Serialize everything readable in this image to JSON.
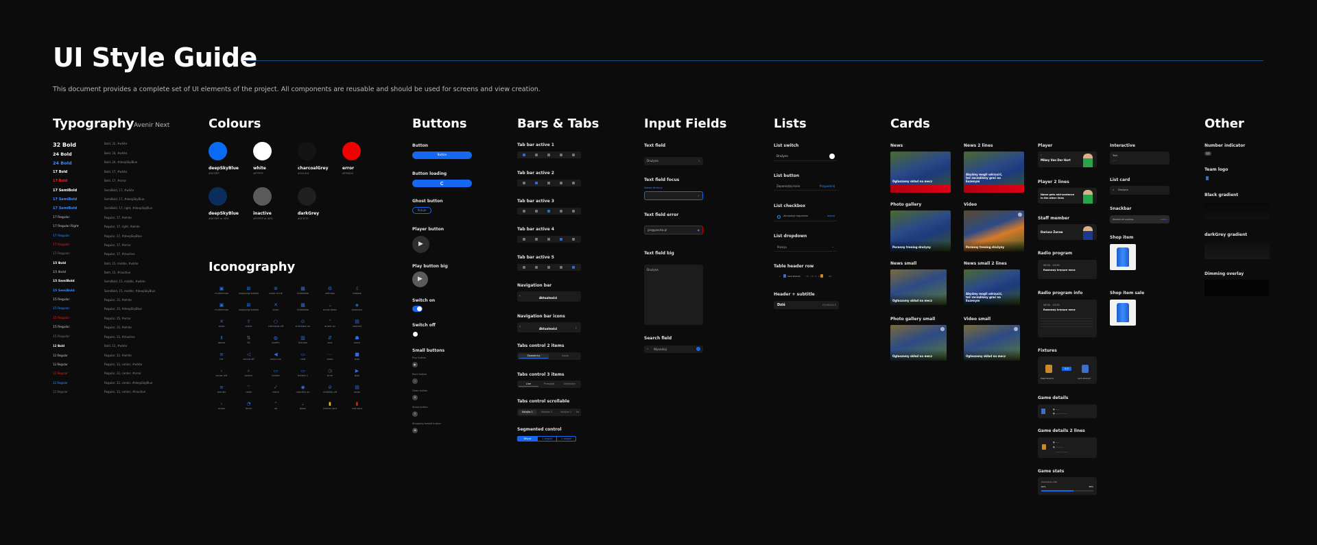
{
  "header": {
    "title": "UI Style Guide",
    "subtitle": "This document provides a complete set of UI elements of the project. All components are reusable and should be used for screens and view creation."
  },
  "typography": {
    "heading": "Typography",
    "font": "Avenir Next",
    "rows": [
      {
        "sample": "32 Bold",
        "spec": "Bold, 32, #white"
      },
      {
        "sample": "24 Bold",
        "spec": "Bold, 24, #white"
      },
      {
        "sample": "24 Bold",
        "spec": "Bold, 24, #deepSkyBlue"
      },
      {
        "sample": "17 Bold",
        "spec": "Bold, 17, #white"
      },
      {
        "sample": "17 Bold",
        "spec": "Bold, 17, #error"
      },
      {
        "sample": "17 SemiBold",
        "spec": "SemiBold, 17, #white"
      },
      {
        "sample": "17 SemiBold",
        "spec": "SemiBold, 17, #deepSkyBlue"
      },
      {
        "sample": "17 SemiBold",
        "spec": "SemiBold, 17, right, #deepSkyBlue"
      },
      {
        "sample": "17 Regular",
        "spec": "Regular, 17, #white"
      },
      {
        "sample": "17 Regular Right",
        "spec": "Regular, 17, right, #white"
      },
      {
        "sample": "17 Regular",
        "spec": "Regular, 17, #deepSkyBlue"
      },
      {
        "sample": "17 Regular",
        "spec": "Regular, 17, #error"
      },
      {
        "sample": "17 Regular",
        "spec": "Regular, 17, #inactive"
      },
      {
        "sample": "15 Bold",
        "spec": "Bold, 15, middle, #white"
      },
      {
        "sample": "15 Bold",
        "spec": "Bold, 15, #inactive"
      },
      {
        "sample": "15 SemiBold",
        "spec": "SemiBold, 15, middle, #white"
      },
      {
        "sample": "15 SemiBold",
        "spec": "SemiBold, 15, middle, #deepSkyBlue"
      },
      {
        "sample": "15 Regular",
        "spec": "Regular, 15, #white"
      },
      {
        "sample": "15 Regular",
        "spec": "Regular, 15, #deepSkyBlue"
      },
      {
        "sample": "15 Regular",
        "spec": "Regular, 15, #error"
      },
      {
        "sample": "15 Regular",
        "spec": "Regular, 15, #white"
      },
      {
        "sample": "15 Regular",
        "spec": "Regular, 15, #inactive"
      },
      {
        "sample": "12 Bold",
        "spec": "Bold, 12, #white"
      },
      {
        "sample": "12 Regular",
        "spec": "Regular, 12, #white"
      },
      {
        "sample": "12 Regular",
        "spec": "Regular, 12, center, #white"
      },
      {
        "sample": "12 Regular",
        "spec": "Regular, 12, center, #error"
      },
      {
        "sample": "12 Regular",
        "spec": "Regular, 12, center, #deepSkyBlue"
      },
      {
        "sample": "12 Regular",
        "spec": "Regular, 12, center, #inactive"
      }
    ]
  },
  "colours": {
    "heading": "Colours",
    "items": [
      {
        "name": "deepSkyBlue",
        "code": "#0076FF",
        "color": "#0a6cf5"
      },
      {
        "name": "white",
        "code": "#FFFFFF",
        "color": "#ffffff"
      },
      {
        "name": "charcoalGrey",
        "code": "#141414",
        "color": "#141414"
      },
      {
        "name": "error",
        "code": "#FF0000",
        "color": "#f00000"
      },
      {
        "name": "deepSkyBlue",
        "code": "#0076FF or 30%",
        "color": "#0a2d5c"
      },
      {
        "name": "inactive",
        "code": "#FFFFFF or 40%",
        "color": "#5a5a5a"
      },
      {
        "name": "darkGrey",
        "code": "#1F1F1F",
        "color": "#1f1f1f"
      }
    ]
  },
  "iconography": {
    "heading": "Iconography",
    "icons": [
      "multimedia",
      "shopping basket",
      "close circle",
      "timetable",
      "settings",
      "release",
      "multimedia",
      "shopping basket",
      "close",
      "timetable",
      "arrow down",
      "sponsors",
      "close",
      "share",
      "checkbox off",
      "checkbox on",
      "arrow up",
      "contact",
      "pause",
      "lift",
      "profile",
      "fixtures",
      "sort",
      "team",
      "list",
      "sound off",
      "sound on",
      "card",
      "more",
      "stop",
      "arrow left",
      "search",
      "tickets",
      "tickets 2",
      "time",
      "play",
      "reorder",
      "radio",
      "check",
      "visibility on",
      "visibility off",
      "news",
      "arrow",
      "timer",
      "up",
      "down",
      "yellow card",
      "red card"
    ]
  },
  "buttons": {
    "heading": "Buttons",
    "button_label": "Button",
    "button_text": "Button",
    "loading_label": "Button loading",
    "ghost_label": "Ghost button",
    "ghost_text": "Rotuje",
    "player_label": "Player button",
    "player_big_label": "Play button big",
    "switch_on_label": "Switch on",
    "switch_off_label": "Switch off",
    "small_label": "Small buttons",
    "small_items": [
      "Play button",
      "Back button",
      "Close button",
      "Share button",
      "Shopping basket button"
    ]
  },
  "bars": {
    "heading": "Bars & Tabs",
    "tabbars": [
      "Tab bar active 1",
      "Tab bar active 2",
      "Tab bar active 3",
      "Tab bar active 4",
      "Tab bar active 5"
    ],
    "navbar_label": "Navigation bar",
    "navbar_title": "Aktualności",
    "navbar_icons_label": "Navigation bar icons",
    "navbar_icons_title": "Aktualności",
    "tabs2_label": "Tabs control 2 items",
    "tabs2": [
      "Zawodnicy",
      "Sztab"
    ],
    "tabs3_label": "Tabs control 3 items",
    "tabs3": [
      "Live",
      "Przegląd",
      "Statystyki"
    ],
    "tabs_scroll_label": "Tabs control scrollable",
    "tabs_scroll": [
      "Kolejka 1",
      "Kolejka 2",
      "Kolejka 3",
      "Ko"
    ],
    "segmented_label": "Segmented control",
    "segmented": [
      "Wszys",
      "1 zespoł",
      "2 zespoł"
    ]
  },
  "inputs": {
    "heading": "Input Fields",
    "text_field_label": "Text field",
    "text_field_value": "Drużyna",
    "focus_label": "Text field focus",
    "focus_hint": "Nazwa drużyny",
    "error_label": "Text field error",
    "error_value": "jan@poczta.pl",
    "big_label": "Text field big",
    "big_value": "Drużyna",
    "search_label": "Search field",
    "search_value": "Wyszukaj"
  },
  "lists": {
    "heading": "Lists",
    "switch_label": "List switch",
    "switch_text": "Drużyna",
    "button_label": "List button",
    "button_text": "Zapamiętaj mnie",
    "button_action": "Przypomnij",
    "checkbox_label": "List checkbox",
    "checkbox_text": "Akceptuję regulamin",
    "checkbox_link": "więcej",
    "dropdown_label": "List dropdown",
    "dropdown_text": "Pozicja",
    "table_header_label": "Table header row",
    "table_header_team": "Lech Poznań",
    "header_sub_label": "Header + subtitle",
    "header_sub_title": "Dziś",
    "header_sub_date": "01/06/2020"
  },
  "cards": {
    "heading": "Cards",
    "news_label": "News",
    "news_caption": "Ogłaszamy skład na mecz",
    "news2_label": "News 2 lines",
    "news2_caption": "Abyśmy mogli odrzucić, też zaczęliśmy grać na Euzenym",
    "gallery_label": "Photo gallery",
    "gallery_caption": "Poranny trening drużyny",
    "video_label": "Video",
    "video_caption": "Poranny trening drużyny",
    "news_small_label": "News small",
    "news_small_caption": "Ogłaszamy skład na mecz",
    "news_small2_label": "News small 2 lines",
    "news_small2_caption": "Abyśmy mogli odrzucić, też zaczęliśmy grać na Euzenym",
    "gallery_small_label": "Photo gallery small",
    "gallery_small_caption": "Ogłaszamy skład na mecz",
    "video_small_label": "Video small",
    "video_small_caption": "Ogłaszamy skład na mecz"
  },
  "other": {
    "heading": "Other",
    "player_label": "Player",
    "player_name": "Mikey Van Der Hart",
    "player2_label": "Player 2 lines",
    "player2_name": "Name gets mid-sentence in the other lines",
    "staff_label": "Staff member",
    "staff_name": "Dariusz Żuraw",
    "radio_label": "Radio program",
    "radio_time": "08:00 - 10:00",
    "radio_title": "Rozmowy kręcące mecz",
    "radio_info_label": "Radio program info",
    "radio_info_time": "08:00 - 10:00",
    "radio_info_title": "Rozmowy kręcące mecz",
    "fixtures_label": "Fixtures",
    "fixtures_home": "Piast Gliwice",
    "fixtures_away": "Lech Poznań",
    "fixtures_score": "0:0",
    "game_details_label": "Game details",
    "game_details2_label": "Game details 2 lines",
    "game_stats_label": "Game stats",
    "game_stats_title": "Posiadanie piłki",
    "game_stats_left": "62%",
    "game_stats_right": "38%",
    "interactive_label": "Interactive",
    "interactive_text": "Text",
    "list_card_label": "List card",
    "list_card_text": "Drużyna",
    "snackbar_label": "Snackbar",
    "snackbar_text": "Wiadomość wysłana",
    "snackbar_action": "Cofnij",
    "shop_label": "Shop item",
    "shop_sale_label": "Shop item sale",
    "number_indicator_label": "Number indicator",
    "number_indicator_value": "12",
    "team_logo_label": "Team logo",
    "black_gradient_label": "Black gradient",
    "darkgrey_gradient_label": "darkGrey gradient",
    "dimming_label": "Dimming overlay"
  }
}
